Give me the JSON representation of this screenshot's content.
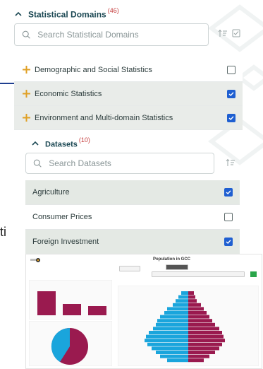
{
  "domains": {
    "title": "Statistical Domains",
    "count": "(46)",
    "search_placeholder": "Search Statistical Domains",
    "items": [
      {
        "label": "Demographic and Social Statistics",
        "checked": false
      },
      {
        "label": "Economic Statistics",
        "checked": true
      },
      {
        "label": "Environment and Multi-domain Statistics",
        "checked": true
      }
    ]
  },
  "datasets": {
    "title": "Datasets",
    "count": "(10)",
    "search_placeholder": "Search Datasets",
    "items": [
      {
        "label": "Agriculture",
        "checked": true
      },
      {
        "label": "Consumer Prices",
        "checked": false
      },
      {
        "label": "Foreign Investment",
        "checked": true
      }
    ]
  },
  "background_text": "ti",
  "thumbnail": {
    "title": "Population in GCC",
    "colors": {
      "male": "#1aa5dc",
      "female": "#9a1a4f"
    }
  },
  "colors": {
    "accent": "#1e4a55",
    "count": "#c53d3d",
    "plus": "#e0a025",
    "checkbox_on": "#1f5fd1"
  }
}
